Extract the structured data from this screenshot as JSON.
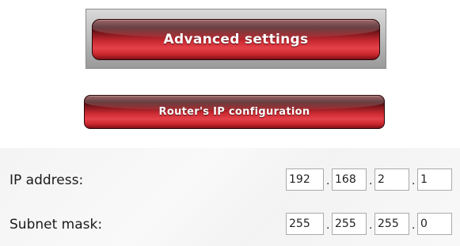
{
  "header": {
    "main_button": "Advanced settings",
    "sub_button": "Router's IP configuration"
  },
  "form": {
    "ip_address": {
      "label": "IP address:",
      "octets": [
        "192",
        "168",
        "2",
        "1"
      ]
    },
    "subnet_mask": {
      "label": "Subnet mask:",
      "octets": [
        "255",
        "255",
        "255",
        "0"
      ]
    },
    "separator": "."
  },
  "colors": {
    "button_red": "#cc2b33",
    "button_dark": "#3a0a0d",
    "panel_bg": "#f4f4f4",
    "field_border": "#aaaaaa"
  }
}
